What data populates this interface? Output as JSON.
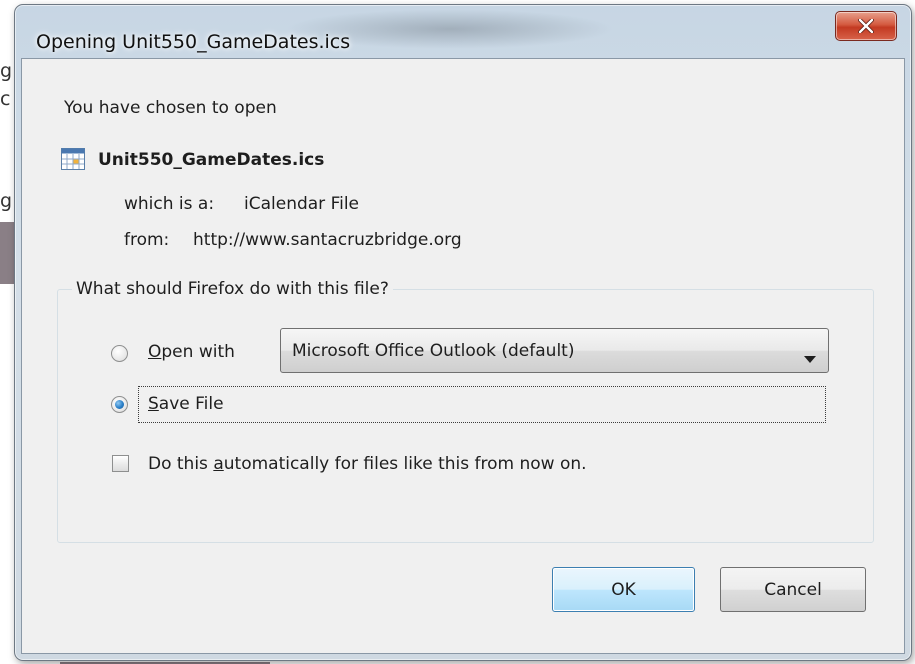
{
  "window": {
    "title": "Opening Unit550_GameDates.ics"
  },
  "dialog": {
    "intro": "You have chosen to open",
    "file_name": "Unit550_GameDates.ics",
    "file_type_label": "which is a:",
    "file_type_value": "iCalendar File",
    "source_label": "from:",
    "source_value": "http://www.santacruzbridge.org",
    "group_label": "What should Firefox do with this file?",
    "open_with": {
      "label_accel": "O",
      "label_rest": "pen with",
      "checked": false
    },
    "application_select": {
      "value": "Microsoft Office Outlook (default)"
    },
    "save_file": {
      "label_accel": "S",
      "label_rest": "ave File",
      "checked": true
    },
    "auto_checkbox": {
      "label_before": "Do this ",
      "label_accel": "a",
      "label_after": "utomatically for files like this from now on.",
      "checked": false
    },
    "buttons": {
      "ok": "OK",
      "cancel": "Cancel"
    }
  },
  "icons": {
    "close": "close-icon",
    "file": "calendar-file-icon",
    "dropdown": "chevron-down-icon"
  },
  "colors": {
    "client_background": "#f0f0f0",
    "close_button": "#c33a22",
    "default_button_border": "#3c7fb1",
    "radio_selected": "#2a7fc8"
  }
}
